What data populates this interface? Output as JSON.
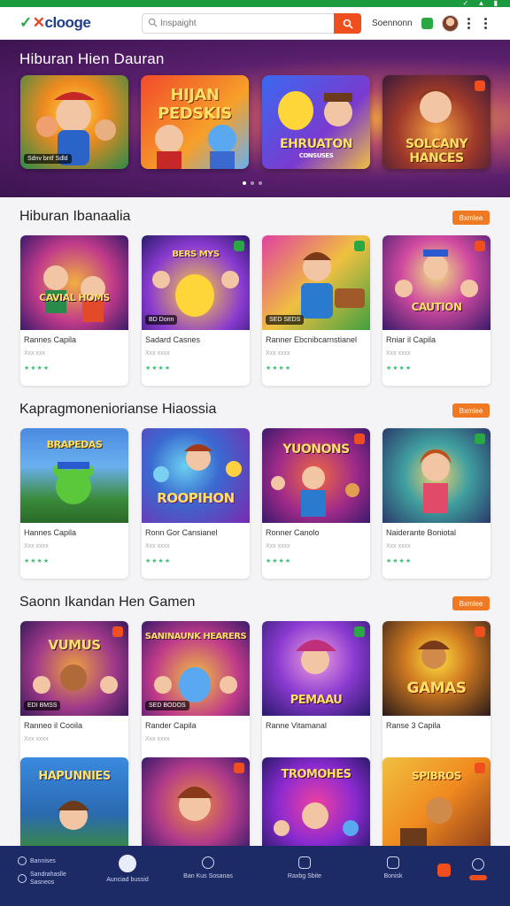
{
  "status_bar": {
    "icons": "✓ ▲ ▮"
  },
  "header": {
    "logo": "clooge",
    "search_placeholder": "Inspaight",
    "right_text": "Soennonn"
  },
  "banner": {
    "title": "Hiburan Hien Dauran",
    "slides": [
      {
        "title": "",
        "tag": "Sdnv bntf Sdld"
      },
      {
        "title": "HIJAN PEDSKIS",
        "tag": ""
      },
      {
        "title": "EHRUATON",
        "subtitle": "CONSUSES",
        "tag": ""
      },
      {
        "title": "SOLCANY HANCES",
        "tag": ""
      }
    ]
  },
  "sections": [
    {
      "title": "Hiburan Ibanaalia",
      "view_label": "Bxmlee",
      "cards": [
        {
          "title": "Rannes Capila",
          "sub": "Xxx xxx",
          "stars": "★★★★",
          "art": "CAVIAL HOMS",
          "tag": ""
        },
        {
          "title": "Sadard Casnes",
          "sub": "Xxx xxxx",
          "stars": "★★★★",
          "art": "BERS MYS",
          "tag": "BD Donn"
        },
        {
          "title": "Ranner Ebcnibcarnstianel",
          "sub": "Xxx xxxx",
          "stars": "★★★★",
          "art": "",
          "tag": "SED SEDS"
        },
        {
          "title": "Rniar il Capila",
          "sub": "Xxx xxxx",
          "stars": "★★★★",
          "art": "CAUTION",
          "tag": ""
        }
      ]
    },
    {
      "title": "Kapragmoneniorianse Hiaossia",
      "view_label": "Bxmlee",
      "cards": [
        {
          "title": "Hannes Capila",
          "sub": "Xxx xxxx",
          "stars": "★★★★",
          "art": "BRAPEDAS",
          "tag": ""
        },
        {
          "title": "Ronn Gor Cansianel",
          "sub": "Xxx xxxx",
          "stars": "★★★★",
          "art": "ROOPIHON",
          "tag": ""
        },
        {
          "title": "Ronner Canolo",
          "sub": "Xxx xxxx",
          "stars": "★★★★",
          "art": "YUONONS",
          "tag": ""
        },
        {
          "title": "Naiderante Boniotal",
          "sub": "Xxx xxxx",
          "stars": "★★★★",
          "art": "",
          "tag": ""
        }
      ]
    },
    {
      "title": "Saonn Ikandan Hen Gamen",
      "view_label": "Bxmlee",
      "cards": [
        {
          "title": "Ranneo il Cooila",
          "sub": "Xxx xxxx",
          "stars": "",
          "art": "VUMUS",
          "tag": "EDI BMSS"
        },
        {
          "title": "Rander Capila",
          "sub": "Xxx xxxx",
          "stars": "",
          "art": "SANINAUNK HEARERS",
          "tag": "SED BODOS"
        },
        {
          "title": "Ranne Vitamanal",
          "sub": "",
          "stars": "",
          "art": "PEMAAU",
          "tag": ""
        },
        {
          "title": "Ranse 3 Capila",
          "sub": "",
          "stars": "",
          "art": "GAMAS",
          "tag": ""
        }
      ]
    },
    {
      "title": "",
      "cards": [
        {
          "art": "HAPUNNIES"
        },
        {
          "art": ""
        },
        {
          "art": "TROMOHES"
        },
        {
          "art": "SPIBROS"
        }
      ]
    }
  ],
  "bottom_nav": [
    {
      "label": "Bannises",
      "sub": "Sandrahaslle Sasneos"
    },
    {
      "label": "Aunciad bussid"
    },
    {
      "label": "Ban Kus Sosanas"
    },
    {
      "label": "Raxbg Sbite"
    },
    {
      "label": "Bonisk"
    },
    {
      "label": ""
    },
    {
      "label": ""
    }
  ],
  "colors": {
    "accent": "#ef4e1f",
    "brand_green": "#2aa843",
    "nav_bg": "#1c2a66",
    "banner": "#5a1f6e"
  }
}
